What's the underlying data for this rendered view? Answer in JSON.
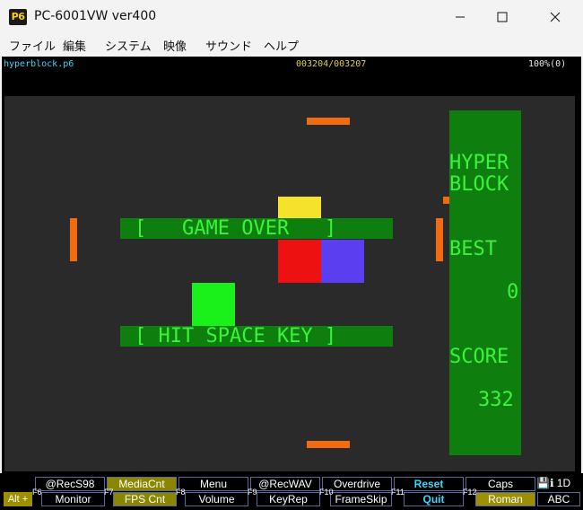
{
  "window": {
    "icon_text": "P6",
    "title": "PC-6001VW ver400"
  },
  "menu": [
    "ファイル",
    "編集",
    "システム",
    "映像",
    "サウンド",
    "ヘルプ"
  ],
  "status_line": {
    "filename": "hyperblock.p6",
    "counter": "003204/003207",
    "speed": "100%(0)"
  },
  "game": {
    "sidebar": {
      "title_line1": "HYPER",
      "title_line2": "BLOCK",
      "best_label": "BEST",
      "best_value": "0",
      "score_label": "SCORE",
      "score_value": "332"
    },
    "game_over_banner": "[   GAME OVER   ]",
    "hit_space_banner": "[ HIT SPACE KEY ]",
    "colors": {
      "background": "#2a2a2a",
      "panel_green": "#0e7f0e",
      "text_green": "#3cf23c",
      "paddle_orange": "#f26b0f",
      "block_yellow": "#f5e22a",
      "block_red": "#ee1111",
      "block_blue": "#5a3ef0",
      "block_green": "#1af01a"
    }
  },
  "function_keys": {
    "top_row": [
      "@RecS98",
      "MediaCnt",
      "Menu",
      "@RecWAV",
      "Overdrive",
      "Reset",
      "Caps"
    ],
    "bottom_row": [
      "Monitor",
      "FPS Cnt",
      "Volume",
      "KeyRep",
      "FrameSkip",
      "Quit",
      "Roman",
      "ABC"
    ],
    "key_numbers": [
      "F6",
      "F7",
      "F8",
      "F9",
      "F10",
      "F11",
      "F12"
    ],
    "alt_label": "Alt +",
    "status_icons": "💾ℹ 1D"
  }
}
